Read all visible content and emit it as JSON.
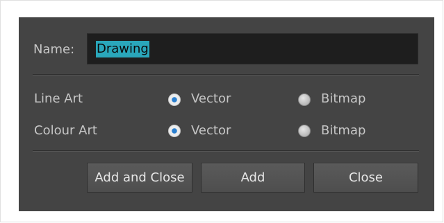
{
  "dialog": {
    "name_label": "Name:",
    "name_value": "Drawing",
    "rows": [
      {
        "label": "Line Art",
        "options": [
          "Vector",
          "Bitmap"
        ],
        "selected": "Vector"
      },
      {
        "label": "Colour Art",
        "options": [
          "Vector",
          "Bitmap"
        ],
        "selected": "Vector"
      }
    ],
    "buttons": {
      "add_and_close": "Add and Close",
      "add": "Add",
      "close": "Close"
    }
  },
  "colors": {
    "dialog_bg": "#444444",
    "selection": "#2aa7bb",
    "radio_selected": "#2a7fcf"
  }
}
